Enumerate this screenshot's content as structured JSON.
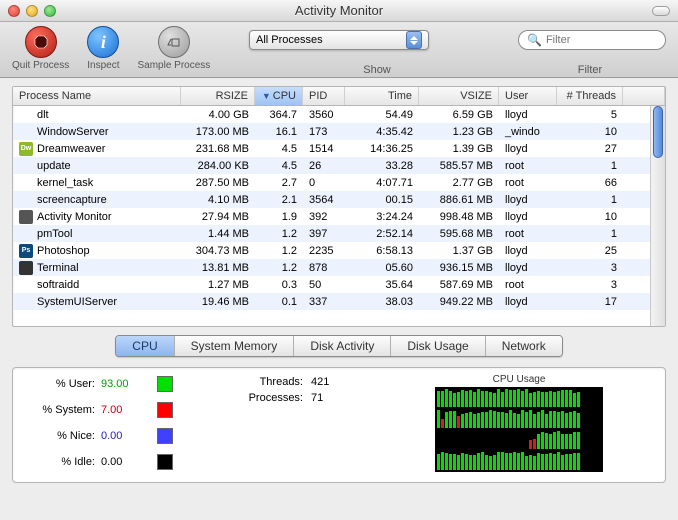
{
  "window_title": "Activity Monitor",
  "toolbar": {
    "quit_label": "Quit Process",
    "inspect_label": "Inspect",
    "sample_label": "Sample Process",
    "show_label": "Show",
    "filter_label": "Filter",
    "show_select_value": "All Processes",
    "filter_placeholder": "Filter"
  },
  "columns": {
    "name": "Process Name",
    "rsize": "RSIZE",
    "cpu": "CPU",
    "pid": "PID",
    "time": "Time",
    "vsize": "VSIZE",
    "user": "User",
    "threads": "# Threads"
  },
  "processes": [
    {
      "name": "dlt",
      "rsize": "4.00 GB",
      "cpu": "364.7",
      "pid": "3560",
      "time": "54.49",
      "vsize": "6.59 GB",
      "user": "lloyd",
      "threads": "5",
      "icon": "none"
    },
    {
      "name": "WindowServer",
      "rsize": "173.00 MB",
      "cpu": "16.1",
      "pid": "173",
      "time": "4:35.42",
      "vsize": "1.23 GB",
      "user": "_windo",
      "threads": "10",
      "icon": "none"
    },
    {
      "name": "Dreamweaver",
      "rsize": "231.68 MB",
      "cpu": "4.5",
      "pid": "1514",
      "time": "14:36.25",
      "vsize": "1.39 GB",
      "user": "lloyd",
      "threads": "27",
      "icon": "dw"
    },
    {
      "name": "update",
      "rsize": "284.00 KB",
      "cpu": "4.5",
      "pid": "26",
      "time": "33.28",
      "vsize": "585.57 MB",
      "user": "root",
      "threads": "1",
      "icon": "none"
    },
    {
      "name": "kernel_task",
      "rsize": "287.50 MB",
      "cpu": "2.7",
      "pid": "0",
      "time": "4:07.71",
      "vsize": "2.77 GB",
      "user": "root",
      "threads": "66",
      "icon": "none"
    },
    {
      "name": "screencapture",
      "rsize": "4.10 MB",
      "cpu": "2.1",
      "pid": "3564",
      "time": "00.15",
      "vsize": "886.61 MB",
      "user": "lloyd",
      "threads": "1",
      "icon": "none"
    },
    {
      "name": "Activity Monitor",
      "rsize": "27.94 MB",
      "cpu": "1.9",
      "pid": "392",
      "time": "3:24.24",
      "vsize": "998.48 MB",
      "user": "lloyd",
      "threads": "10",
      "icon": "am"
    },
    {
      "name": "pmTool",
      "rsize": "1.44 MB",
      "cpu": "1.2",
      "pid": "397",
      "time": "2:52.14",
      "vsize": "595.68 MB",
      "user": "root",
      "threads": "1",
      "icon": "none"
    },
    {
      "name": "Photoshop",
      "rsize": "304.73 MB",
      "cpu": "1.2",
      "pid": "2235",
      "time": "6:58.13",
      "vsize": "1.37 GB",
      "user": "lloyd",
      "threads": "25",
      "icon": "ps"
    },
    {
      "name": "Terminal",
      "rsize": "13.81 MB",
      "cpu": "1.2",
      "pid": "878",
      "time": "05.60",
      "vsize": "936.15 MB",
      "user": "lloyd",
      "threads": "3",
      "icon": "term"
    },
    {
      "name": "softraidd",
      "rsize": "1.27 MB",
      "cpu": "0.3",
      "pid": "50",
      "time": "35.64",
      "vsize": "587.69 MB",
      "user": "root",
      "threads": "3",
      "icon": "none"
    },
    {
      "name": "SystemUIServer",
      "rsize": "19.46 MB",
      "cpu": "0.1",
      "pid": "337",
      "time": "38.03",
      "vsize": "949.22 MB",
      "user": "lloyd",
      "threads": "17",
      "icon": "none"
    }
  ],
  "tabs": [
    "CPU",
    "System Memory",
    "Disk Activity",
    "Disk Usage",
    "Network"
  ],
  "active_tab": 0,
  "cpu_stats": {
    "pct_user_label": "% User:",
    "pct_user_value": "93.00",
    "pct_user_color": "#00d000",
    "pct_system_label": "% System:",
    "pct_system_value": "7.00",
    "pct_system_color": "#d00000",
    "pct_nice_label": "% Nice:",
    "pct_nice_value": "0.00",
    "pct_nice_color": "#2020d0",
    "pct_idle_label": "% Idle:",
    "pct_idle_value": "0.00",
    "pct_idle_color": "#000000",
    "threads_label": "Threads:",
    "threads_value": "421",
    "processes_label": "Processes:",
    "processes_value": "71",
    "graph_title": "CPU Usage"
  },
  "colors": {
    "swatch_user": "#00e000",
    "swatch_system": "#ff0000",
    "swatch_nice": "#4040ff",
    "swatch_idle": "#000000"
  }
}
